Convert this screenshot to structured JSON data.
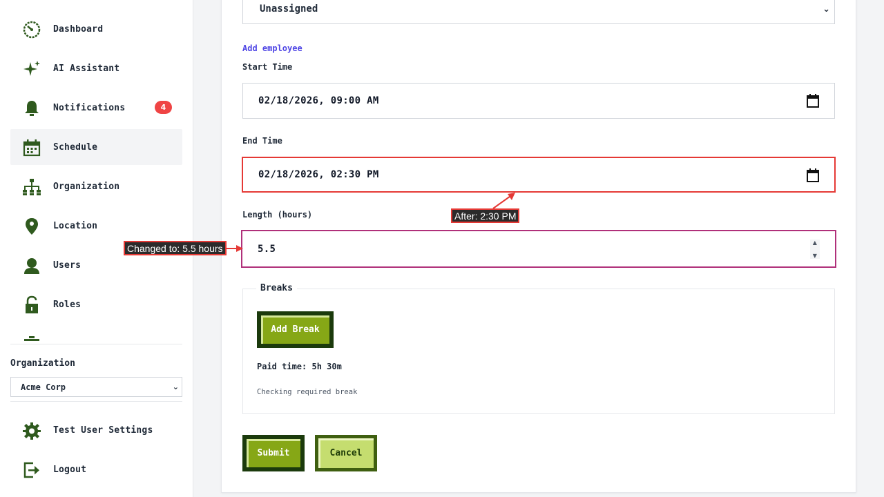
{
  "sidebar": {
    "items": [
      {
        "label": "Dashboard",
        "icon": "dashboard-icon"
      },
      {
        "label": "AI Assistant",
        "icon": "sparkle-icon"
      },
      {
        "label": "Notifications",
        "icon": "bell-icon",
        "badge": "4"
      },
      {
        "label": "Schedule",
        "icon": "calendar-icon",
        "active": true
      },
      {
        "label": "Organization",
        "icon": "org-chart-icon"
      },
      {
        "label": "Location",
        "icon": "location-pin-icon"
      },
      {
        "label": "Users",
        "icon": "user-icon"
      },
      {
        "label": "Roles",
        "icon": "lock-icon"
      }
    ],
    "org_label": "Organization",
    "org_select_value": "Acme Corp",
    "settings_label": "Test User Settings",
    "logout_label": "Logout"
  },
  "form": {
    "employee_select_value": "Unassigned",
    "add_employee_link": "Add employee",
    "start_time_label": "Start Time",
    "start_time_value": "02/18/2026, 09:00 AM",
    "end_time_label": "End Time",
    "end_time_value": "02/18/2026, 02:30 PM",
    "length_label": "Length (hours)",
    "length_value": "5.5",
    "breaks_legend": "Breaks",
    "add_break_label": "Add Break",
    "paid_time_text": "Paid time: 5h 30m",
    "checking_text": "Checking required break",
    "submit_label": "Submit",
    "cancel_label": "Cancel"
  },
  "annotations": {
    "end_time_note": "After: 2:30 PM",
    "length_note": "Changed to: 5.5 hours"
  },
  "colors": {
    "icon_green": "#2f5a1e",
    "badge_red": "#ef4444",
    "highlight_red": "#e53935",
    "highlight_purple": "#b0307a",
    "button_green": "#86a716",
    "link": "#4f46e5"
  }
}
